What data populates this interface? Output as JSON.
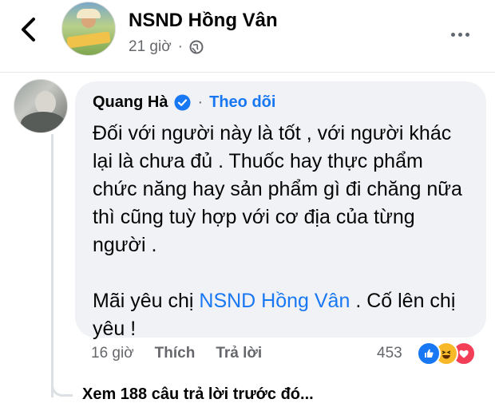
{
  "post": {
    "author": "NSND Hồng Vân",
    "time": "21 giờ",
    "meta_sep": "·",
    "privacy_icon": "globe-icon"
  },
  "comment": {
    "author": "Quang Hà",
    "verified_icon": "verified-badge-icon",
    "follow_sep": "·",
    "follow_label": "Theo dõi",
    "paragraph1": "Đối với người này là tốt , với người khác lại là chưa đủ . Thuốc hay thực phẩm chức năng hay sản phẩm gì đi chăng nữa thì cũng tuỳ hợp với cơ địa của từng người .",
    "p2_before": "Mãi yêu chị ",
    "p2_mention": "NSND Hồng Vân",
    "p2_after": " . Cố lên chị yêu !",
    "time": "16 giờ",
    "like_label": "Thích",
    "reply_label": "Trả lời",
    "reaction_count": "453",
    "reactions": [
      "like",
      "haha",
      "love"
    ]
  },
  "view_replies": "Xem 188 câu trả lời trước đó...",
  "colors": {
    "accent": "#1877f2",
    "bubble": "#f0f2f5",
    "secondary_text": "#65676b",
    "like": "#1877f2",
    "haha": "#f7b928",
    "love": "#f33e58"
  }
}
